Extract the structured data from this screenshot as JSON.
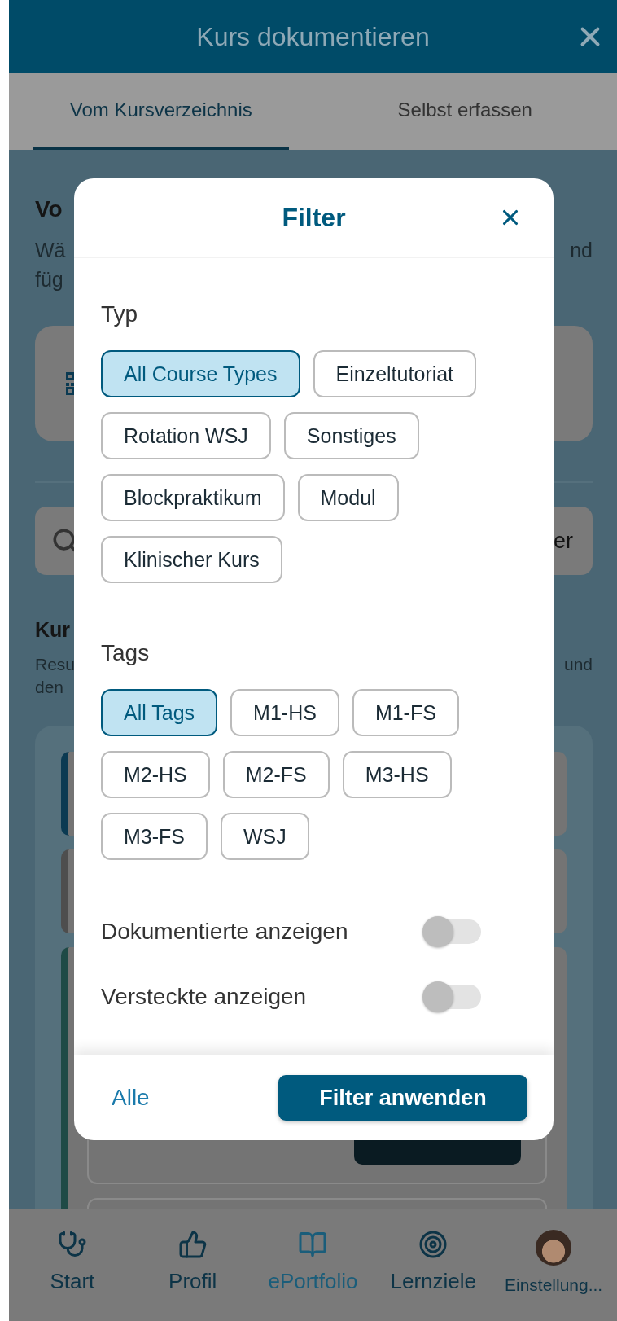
{
  "header": {
    "title": "Kurs dokumentieren"
  },
  "tabs": [
    {
      "label": "Vom Kursverzeichnis",
      "selected": true
    },
    {
      "label": "Selbst erfassen",
      "selected": false
    }
  ],
  "background": {
    "intro_heading": "Vo",
    "intro_lines": [
      {
        "left": "Wä",
        "right": "nd"
      },
      {
        "left": "füg"
      }
    ],
    "search_right": "er",
    "list_heading": "Kur",
    "list_lines": [
      {
        "left": "Resu",
        "right": "und"
      },
      {
        "left": "den"
      }
    ],
    "course_cards": [
      {
        "color": "#0b3a52"
      },
      {
        "color": "#4e4e4e"
      },
      {
        "color": "#1e4a46"
      }
    ]
  },
  "filter": {
    "title": "Filter",
    "sections": [
      {
        "heading": "Typ",
        "chips": [
          {
            "label": "All Course Types",
            "selected": true
          },
          {
            "label": "Einzeltutoriat",
            "selected": false
          },
          {
            "label": "Rotation WSJ",
            "selected": false
          },
          {
            "label": "Sonstiges",
            "selected": false
          },
          {
            "label": "Blockpraktikum",
            "selected": false
          },
          {
            "label": "Modul",
            "selected": false
          },
          {
            "label": "Klinischer Kurs",
            "selected": false
          }
        ]
      },
      {
        "heading": "Tags",
        "chips": [
          {
            "label": "All Tags",
            "selected": true
          },
          {
            "label": "M1-HS",
            "selected": false
          },
          {
            "label": "M1-FS",
            "selected": false
          },
          {
            "label": "M2-HS",
            "selected": false
          },
          {
            "label": "M2-FS",
            "selected": false
          },
          {
            "label": "M3-HS",
            "selected": false
          },
          {
            "label": "M3-FS",
            "selected": false
          },
          {
            "label": "WSJ",
            "selected": false
          }
        ]
      }
    ],
    "toggles": [
      {
        "label": "Dokumentierte anzeigen",
        "on": false
      },
      {
        "label": "Versteckte anzeigen",
        "on": false
      }
    ],
    "reset_link": "Alle",
    "apply_button": "Filter anwenden"
  },
  "bottom_nav": [
    {
      "label": "Start",
      "kind": "icon",
      "selected": false
    },
    {
      "label": "Profil",
      "kind": "icon",
      "selected": false
    },
    {
      "label": "ePortfolio",
      "kind": "icon",
      "selected": true
    },
    {
      "label": "Lernziele",
      "kind": "icon",
      "selected": false
    },
    {
      "label": "Einstellung...",
      "kind": "avatar",
      "selected": false
    }
  ]
}
